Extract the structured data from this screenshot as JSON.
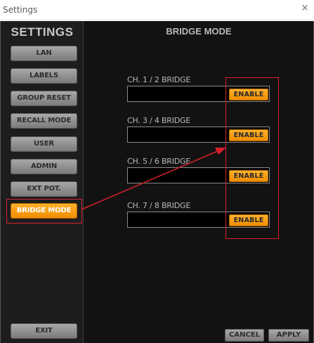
{
  "window": {
    "title": "Settings",
    "close_glyph": "×"
  },
  "sidebar": {
    "title": "SETTINGS",
    "items": [
      {
        "label": "LAN",
        "active": false
      },
      {
        "label": "LABELS",
        "active": false
      },
      {
        "label": "GROUP RESET",
        "active": false
      },
      {
        "label": "RECALL MODE",
        "active": false
      },
      {
        "label": "USER",
        "active": false
      },
      {
        "label": "ADMIN",
        "active": false
      },
      {
        "label": "EXT POT.",
        "active": false
      },
      {
        "label": "BRIDGE MODE",
        "active": true
      }
    ],
    "exit_label": "EXIT"
  },
  "main": {
    "title": "BRIDGE MODE",
    "channels": [
      {
        "label": "CH. 1 / 2 BRIDGE",
        "value": "",
        "button": "ENABLE"
      },
      {
        "label": "CH. 3 / 4 BRIDGE",
        "value": "",
        "button": "ENABLE"
      },
      {
        "label": "CH. 5 / 6 BRIDGE",
        "value": "",
        "button": "ENABLE"
      },
      {
        "label": "CH. 7 / 8 BRIDGE",
        "value": "",
        "button": "ENABLE"
      }
    ],
    "cancel_label": "CANCEL",
    "apply_label": "APPLY"
  },
  "colors": {
    "accent": "#f59b10",
    "annotation": "#d8202e",
    "button_grey": "#8e8e8e",
    "background": "#161616"
  }
}
